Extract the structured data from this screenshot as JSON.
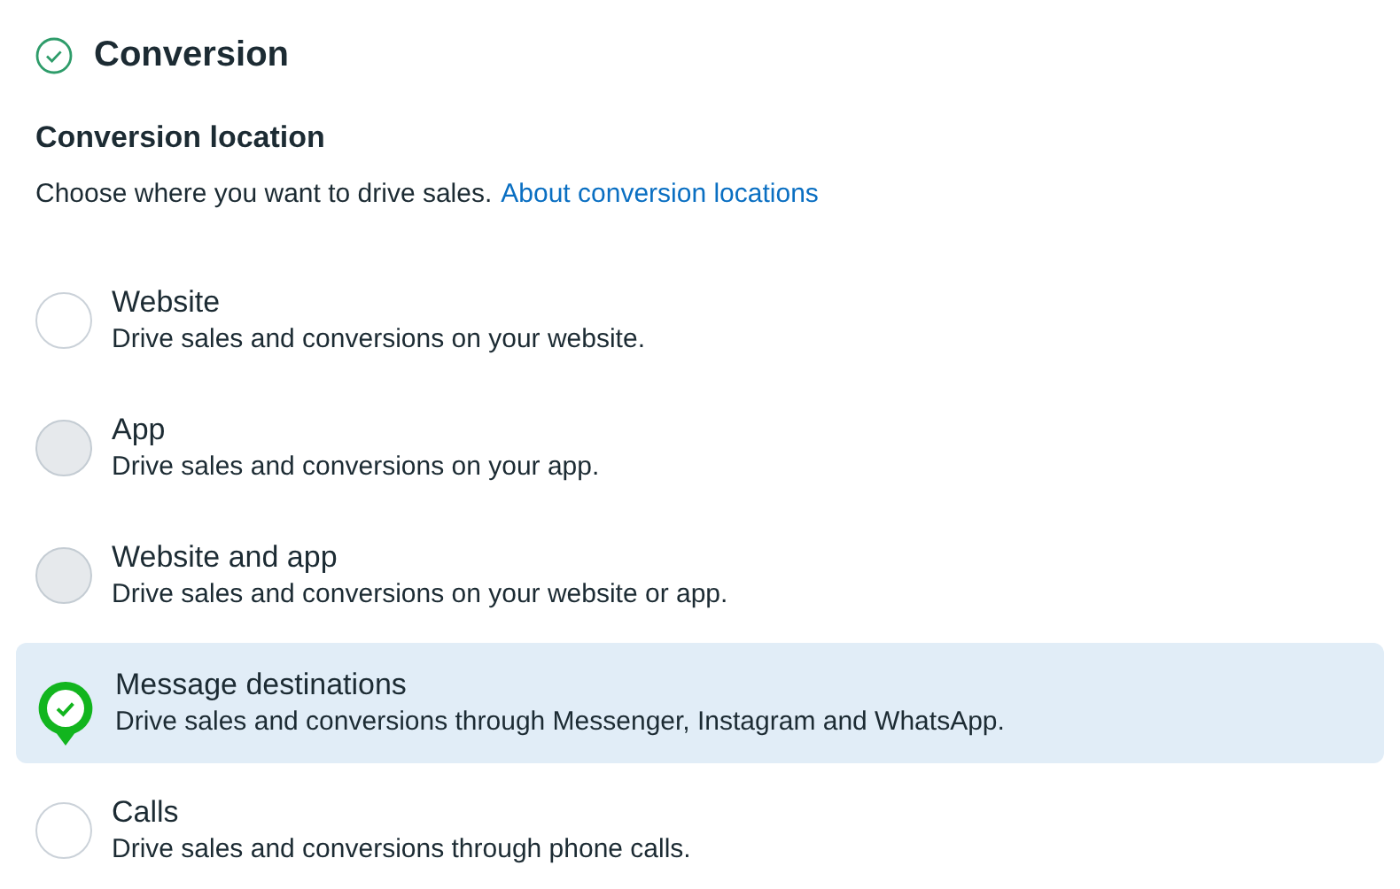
{
  "section": {
    "title": "Conversion",
    "complete": true
  },
  "location": {
    "heading": "Conversion location",
    "description": "Choose where you want to drive sales.",
    "link": "About conversion locations"
  },
  "options": [
    {
      "label": "Website",
      "description": "Drive sales and conversions on your website.",
      "selected": false,
      "disabled": false
    },
    {
      "label": "App",
      "description": "Drive sales and conversions on your app.",
      "selected": false,
      "disabled": true
    },
    {
      "label": "Website and app",
      "description": "Drive sales and conversions on your website or app.",
      "selected": false,
      "disabled": true
    },
    {
      "label": "Message destinations",
      "description": "Drive sales and conversions through Messenger, Instagram and WhatsApp.",
      "selected": true,
      "disabled": false
    },
    {
      "label": "Calls",
      "description": "Drive sales and conversions through phone calls.",
      "selected": false,
      "disabled": false
    }
  ]
}
